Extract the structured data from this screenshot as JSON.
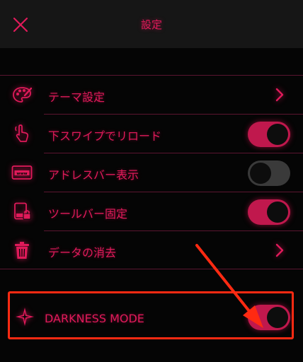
{
  "header": {
    "title": "設定",
    "close_icon": "close-icon"
  },
  "settings": [
    {
      "label": "テーマ設定",
      "icon": "palette-icon",
      "control": "chevron"
    },
    {
      "label": "下スワイプでリロード",
      "icon": "swipe-hand-icon",
      "control": "toggle",
      "value": true
    },
    {
      "label": "アドレスバー表示",
      "icon": "www-address-icon",
      "control": "toggle",
      "value": false
    },
    {
      "label": "ツールバー固定",
      "icon": "toolbar-lock-icon",
      "control": "toggle",
      "value": true
    },
    {
      "label": "データの消去",
      "icon": "trash-icon",
      "control": "chevron"
    }
  ],
  "darkness": {
    "label": "DARKNESS MODE",
    "icon": "sparkle-icon",
    "value": true
  },
  "colors": {
    "accent": "#e01a5a",
    "toggle_on": "#c0184d",
    "toggle_off": "#3a3a3a",
    "annotation": "#ff2a12"
  }
}
